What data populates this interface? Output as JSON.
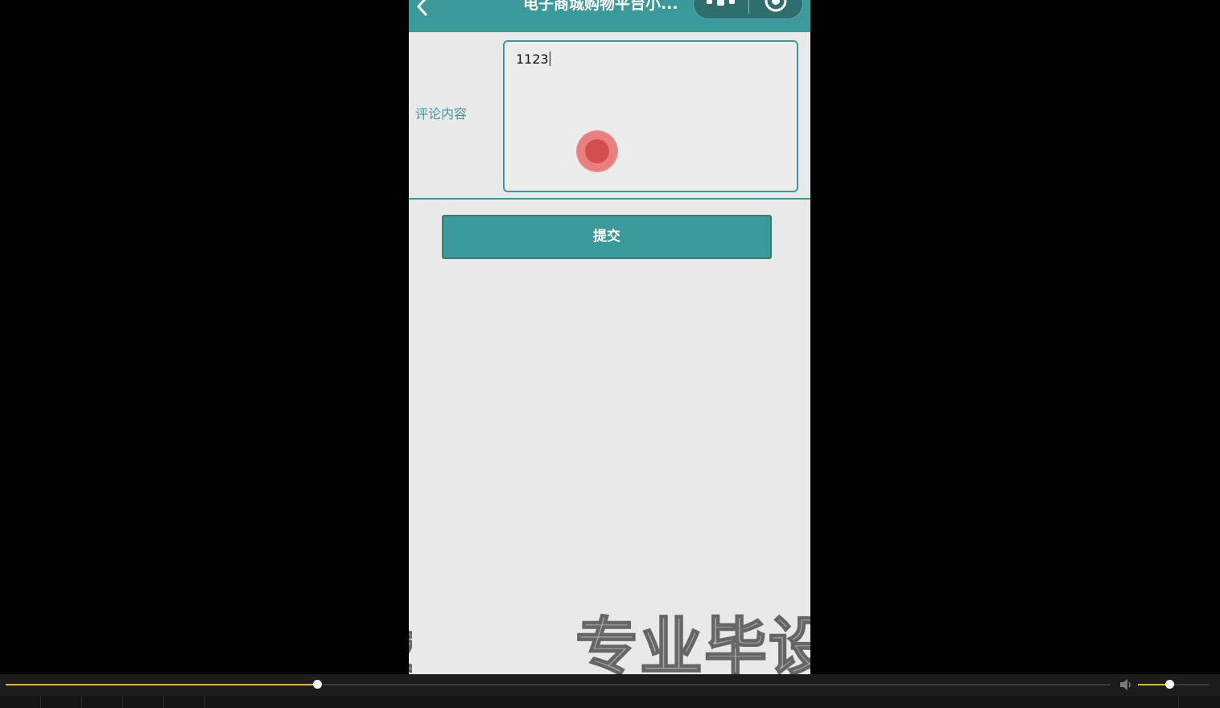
{
  "navbar": {
    "title": "电子商城购物平台小...",
    "background_color": "#3a9a9a"
  },
  "icons": {
    "back": "chevron-left-icon",
    "menu": "more-dots-icon",
    "close": "target-circle-icon",
    "volume": "speaker-icon"
  },
  "form": {
    "comment_label": "评论内容",
    "comment_value": "1123",
    "submit_label": "提交"
  },
  "watermark": {
    "text": "专业毕设"
  },
  "player": {
    "progress_fraction": 0.282,
    "volume_fraction": 0.44,
    "accent_color": "#e3b717"
  }
}
